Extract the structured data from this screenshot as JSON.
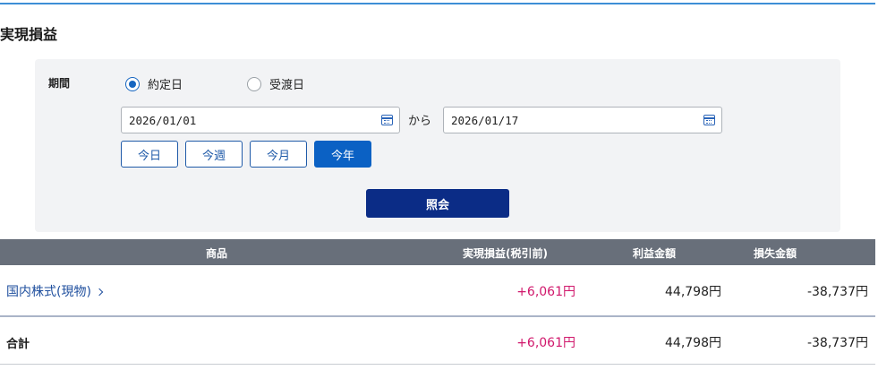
{
  "page_title": "実現損益",
  "filter": {
    "period_label": "期間",
    "radio_options": [
      {
        "label": "約定日",
        "checked": true
      },
      {
        "label": "受渡日",
        "checked": false
      }
    ],
    "date_from": "2026/01/01",
    "date_to": "2026/01/17",
    "range_connector": "から",
    "quick_buttons": [
      {
        "label": "今日",
        "active": false
      },
      {
        "label": "今週",
        "active": false
      },
      {
        "label": "今月",
        "active": false
      },
      {
        "label": "今年",
        "active": true
      }
    ],
    "submit_label": "照会"
  },
  "table": {
    "headers": [
      "商品",
      "実現損益(税引前)",
      "利益金額",
      "損失金額"
    ],
    "rows": [
      {
        "product": "国内株式(現物)",
        "realized": "+6,061円",
        "profit": "44,798円",
        "loss": "-38,737円"
      }
    ],
    "total": {
      "product": "合計",
      "realized": "+6,061円",
      "profit": "44,798円",
      "loss": "-38,737円"
    }
  },
  "colors": {
    "accent": "#0b61c4",
    "submit": "#0b2c86",
    "header_bg": "#686f7a",
    "gain": "#d0176b",
    "top_rule": "#3d8fd6"
  },
  "icons": [
    "calendar-icon",
    "chevron-right-icon"
  ]
}
